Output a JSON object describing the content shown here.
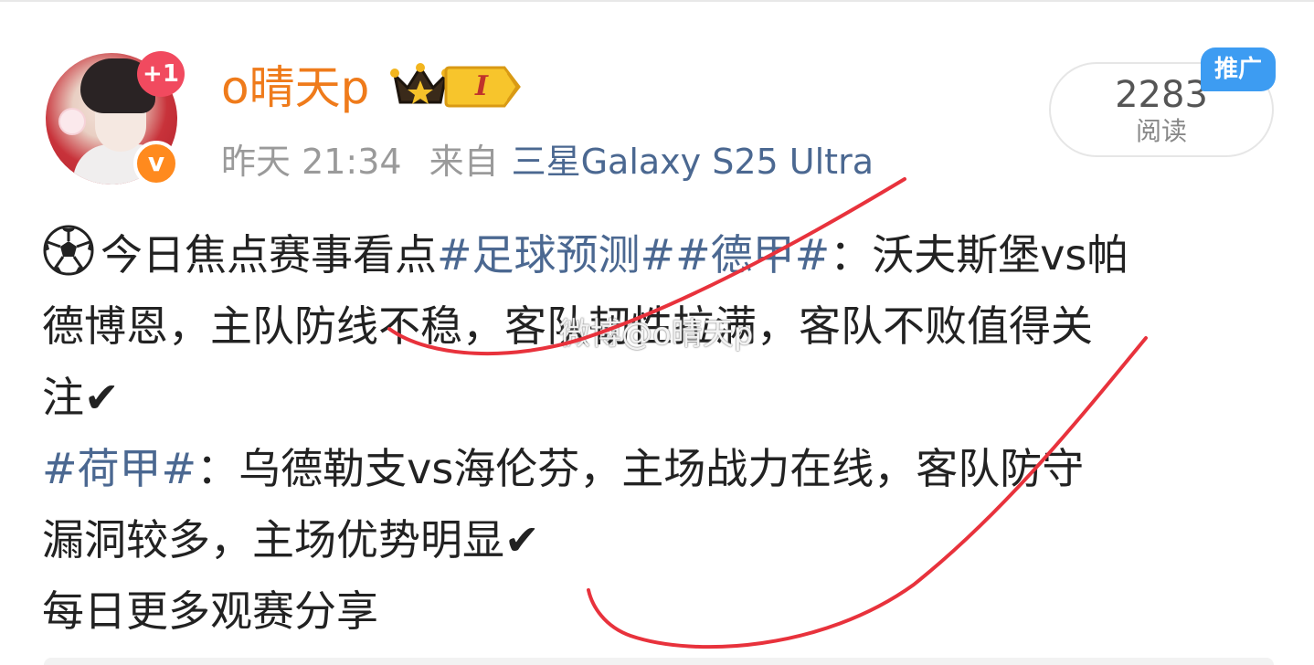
{
  "user": {
    "name": "o晴天p",
    "follow_badge": "+1",
    "level_badge": "I",
    "verified_mark": "v"
  },
  "meta": {
    "time": "昨天 21:34",
    "source_label": "来自",
    "source_device": "三星Galaxy S25 Ultra"
  },
  "reads": {
    "count": "2283",
    "label": "阅读",
    "promo_tag": "推广"
  },
  "post": {
    "line1_prefix": "今日焦点赛事看点",
    "tag_football": "#足球预测#",
    "tag_bundesliga": "#德甲#",
    "line1_suffix": "：沃夫斯堡vs帕",
    "line2": "德博恩，主队防线不稳，客队韧性拉满，客队不败值得关",
    "line3": "注✔",
    "tag_eredivisie": "#荷甲#",
    "line4_suffix": "：乌德勒支vs海伦芬，主场战力在线，客队防守",
    "line5": "漏洞较多，主场优势明显✔",
    "line6": "每日更多观赛分享"
  },
  "watermark": "微博@o晴天p",
  "colors": {
    "username": "#ef7b1b",
    "hashtag": "#4b6891",
    "meta": "#9a9a9a",
    "promo": "#3d9cf2",
    "scribble": "#e8323c"
  }
}
